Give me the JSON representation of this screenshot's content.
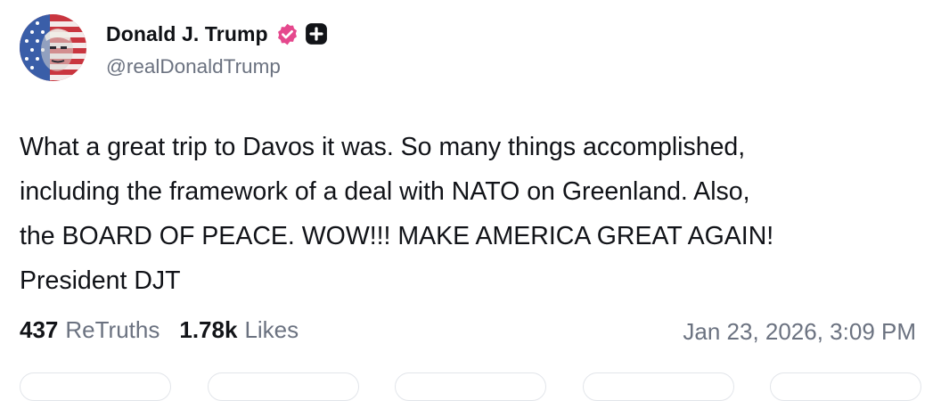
{
  "post": {
    "author": {
      "display_name": "Donald J. Trump",
      "handle": "@realDonaldTrump",
      "avatar_icon": "avatar-flag-portrait",
      "verified_icon": "verified-badge-icon",
      "verified_color": "#e5488d",
      "plus_icon": "plus-badge-icon"
    },
    "text": "What a great trip to Davos it was. So many things accomplished,\nincluding the framework of a deal with NATO on Greenland. Also,\nthe BOARD OF PEACE. WOW!!! MAKE AMERICA GREAT AGAIN!\nPresident DJT",
    "stats": {
      "retruths_count": "437",
      "retruths_label": "ReTruths",
      "likes_count": "1.78k",
      "likes_label": "Likes"
    },
    "timestamp": "Jan 23, 2026, 3:09 PM"
  },
  "action_bar": {
    "buttons": [
      "reply",
      "retruth",
      "like",
      "share",
      "more"
    ]
  }
}
